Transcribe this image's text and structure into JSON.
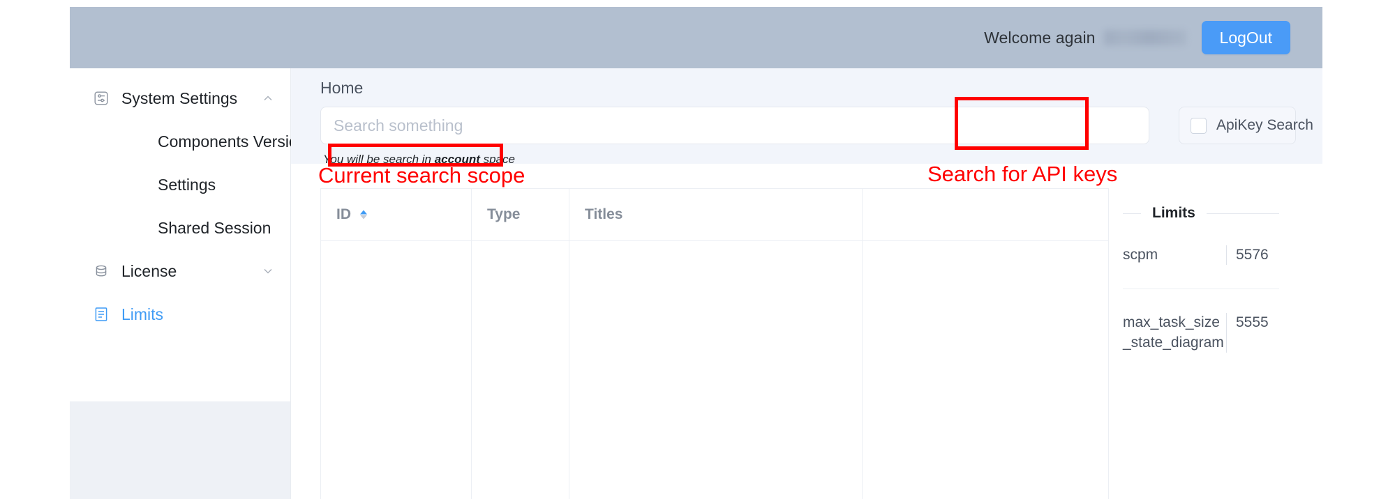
{
  "header": {
    "welcome_text": "Welcome again",
    "username_redacted": "",
    "logout_label": "LogOut"
  },
  "sidebar": {
    "items": [
      {
        "label": "System Settings",
        "icon": "sliders-icon",
        "chevron": "chevron-up-icon",
        "active": false
      },
      {
        "label": "Components Versions",
        "icon": "",
        "active": false
      },
      {
        "label": "Settings",
        "icon": "",
        "active": false
      },
      {
        "label": "Shared Session",
        "icon": "",
        "active": false
      },
      {
        "label": "License",
        "icon": "database-icon",
        "chevron": "chevron-down-icon",
        "active": false
      },
      {
        "label": "Limits",
        "icon": "document-list-icon",
        "active": true
      }
    ]
  },
  "main": {
    "breadcrumb": "Home",
    "search": {
      "value": "",
      "placeholder": "Search something"
    },
    "scope_hint": {
      "prefix": "You will be search in ",
      "scope": "account",
      "suffix": " space"
    },
    "apikey_search": {
      "label": "ApiKey Search",
      "checked": false
    },
    "table": {
      "columns": [
        {
          "label": "ID",
          "sortable": true,
          "sort_state": "asc"
        },
        {
          "label": "Type",
          "sortable": false
        },
        {
          "label": "Titles",
          "sortable": false
        },
        {
          "label": "",
          "sortable": false
        }
      ],
      "rows": []
    },
    "limits_panel": {
      "title": "Limits",
      "entries": [
        {
          "key": "scpm",
          "value": "5576"
        },
        {
          "key": "max_task_size_state_diagram",
          "value": "5555"
        }
      ]
    }
  },
  "annotations": {
    "scope_label": "Current search scope",
    "apikey_label": "Search for API keys",
    "color": "#ff0000"
  },
  "colors": {
    "accent_blue": "#4a9bf7",
    "header_bar": "#b2bfd0",
    "band_background": "#f2f5fb",
    "annotation_red": "#ff0000"
  }
}
